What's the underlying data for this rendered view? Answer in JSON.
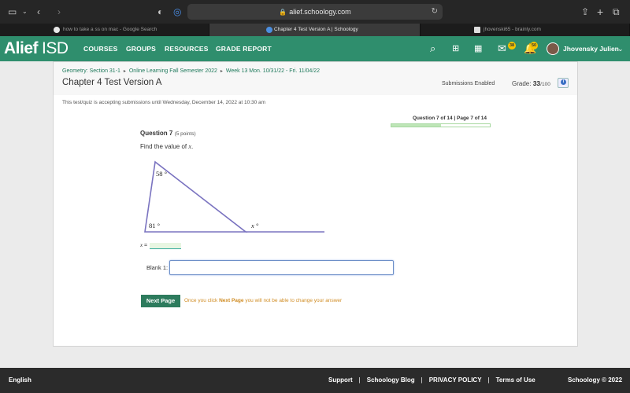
{
  "browser": {
    "url": "alief.schoology.com",
    "tabs": [
      {
        "label": "how to take a ss on mac - Google Search",
        "favicon_color": "#e8e8e8"
      },
      {
        "label": "Chapter 4 Test Version A | Schoology",
        "favicon_color": "#4c8fe0"
      },
      {
        "label": "jhovenski65 - brainly.com",
        "favicon_color": "#dddddd"
      }
    ]
  },
  "nav": {
    "logo": "Alief",
    "logo_suffix": "ISD",
    "links": [
      "COURSES",
      "GROUPS",
      "RESOURCES",
      "GRADE REPORT"
    ],
    "messages_badge": "38",
    "notifications_badge": "50",
    "user_name": "Jhovensky Julien"
  },
  "header": {
    "breadcrumbs": [
      "Geometry: Section 31-1",
      "Online Learning Fall Semester 2022",
      "Week 13 Mon. 10/31/22 - Fri. 11/04/22"
    ],
    "title": "Chapter 4 Test Version A",
    "submissions": "Submissions Enabled",
    "grade_label": "Grade:",
    "grade_value": "33",
    "grade_total": "/100"
  },
  "notice": "This test/quiz is accepting submissions until Wednesday, December 14, 2022 at 10:30 am",
  "progress": {
    "label": "Question 7 of 14 | Page 7 of 14",
    "fraction": 0.5
  },
  "question": {
    "title": "Question 7",
    "points": "(5 points)",
    "prompt_prefix": "Find the value of ",
    "prompt_var": "x",
    "prompt_suffix": ".",
    "angle_top": "58 °",
    "angle_left": "81 °",
    "angle_ext": "x °",
    "answer_prefix": "x",
    "answer_eq": " =",
    "blank_label": "Blank 1:",
    "blank_value": ""
  },
  "actions": {
    "next_label": "Next Page",
    "warn_prefix": "Once you click ",
    "warn_bold": "Next Page",
    "warn_suffix": " you will not be able to change your answer"
  },
  "footer": {
    "language": "English",
    "links": [
      "Support",
      "Schoology Blog",
      "PRIVACY POLICY",
      "Terms of Use"
    ],
    "copyright": "Schoology © 2022"
  },
  "colors": {
    "brand": "#2f8e6d",
    "button": "#2d7b5d",
    "warning": "#d08c23",
    "triangle": "#7a73c0"
  }
}
